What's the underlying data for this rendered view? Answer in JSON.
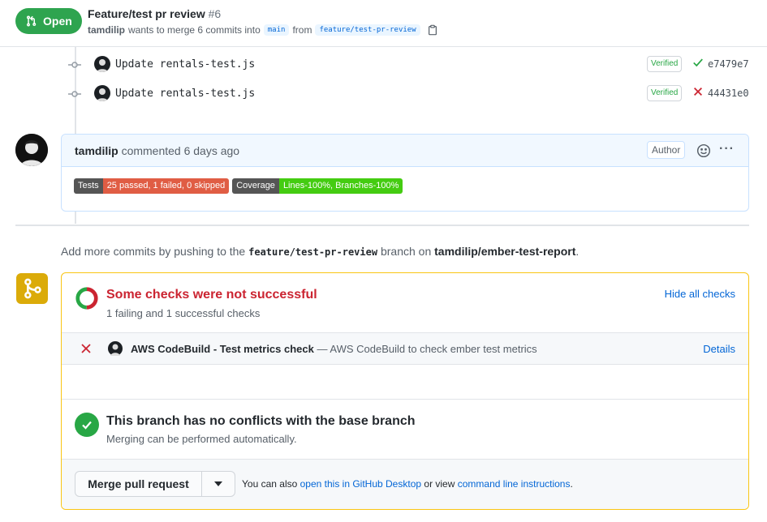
{
  "header": {
    "state": "Open",
    "title": "Feature/test pr review",
    "number": "#6",
    "author": "tamdilip",
    "merge_text": "wants to merge 6 commits into",
    "base_branch": "main",
    "from_text": "from",
    "head_branch": "feature/test-pr-review"
  },
  "commits": [
    {
      "message": "Update rentals-test.js",
      "verified": "Verified",
      "status": "success",
      "sha": "e7479e7"
    },
    {
      "message": "Update rentals-test.js",
      "verified": "Verified",
      "status": "failure",
      "sha": "44431e0"
    }
  ],
  "comment": {
    "author": "tamdilip",
    "meta": "commented 6 days ago",
    "author_label": "Author",
    "badges": [
      {
        "label": "Tests",
        "value": "25 passed, 1 failed, 0 skipped",
        "color": "#e05d44"
      },
      {
        "label": "Coverage",
        "value": "Lines-100%, Branches-100%",
        "color": "#4c1"
      }
    ]
  },
  "push_info": {
    "prefix": "Add more commits by pushing to the",
    "branch": "feature/test-pr-review",
    "middle": "branch on",
    "repo": "tamdilip/ember-test-report",
    "suffix": "."
  },
  "checks": {
    "title": "Some checks were not successful",
    "subtitle": "1 failing and 1 successful checks",
    "toggle": "Hide all checks",
    "items": [
      {
        "name": "AWS CodeBuild - Test metrics check",
        "description": "— AWS CodeBuild to check ember test metrics",
        "link": "Details",
        "status": "failure"
      }
    ]
  },
  "conflicts": {
    "title": "This branch has no conflicts with the base branch",
    "subtitle": "Merging can be performed automatically."
  },
  "merge": {
    "button": "Merge pull request",
    "alt_prefix": "You can also",
    "alt_link1": "open this in GitHub Desktop",
    "alt_middle": "or view",
    "alt_link2": "command line instructions",
    "alt_suffix": "."
  },
  "colors": {
    "open_green": "#2ea44f",
    "fail_red": "#cb2431",
    "link_blue": "#0366d6",
    "merge_yellow": "#dbab09"
  }
}
